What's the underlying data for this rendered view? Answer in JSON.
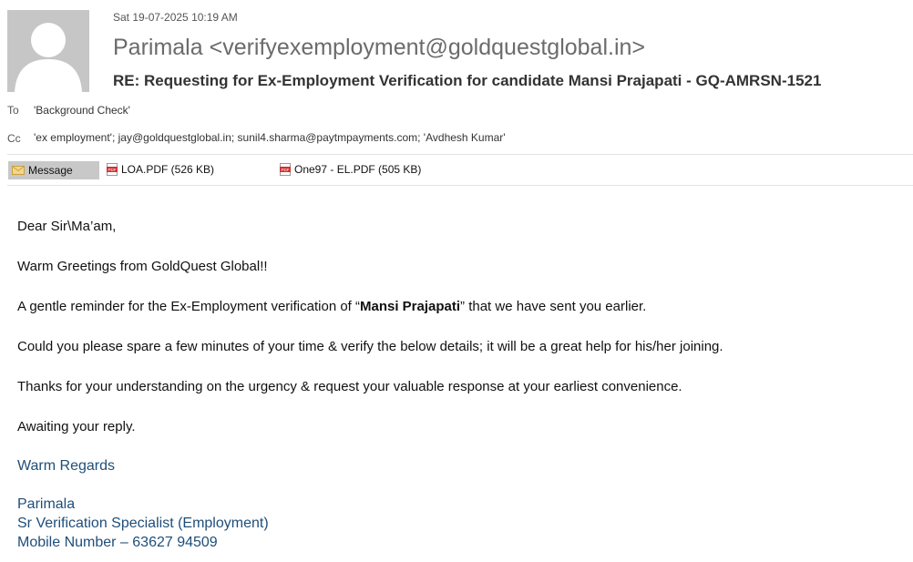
{
  "header": {
    "datetime": "Sat 19-07-2025 10:19 AM",
    "sender": "Parimala <verifyexemployment@goldquestglobal.in>",
    "subject": "RE: Requesting for Ex-Employment Verification for candidate Mansi Prajapati - GQ-AMRSN-1521",
    "to_label": "To",
    "to_value": "'Background Check'",
    "cc_label": "Cc",
    "cc_value": "'ex employment'; jay@goldquestglobal.in; sunil4.sharma@paytmpayments.com; 'Avdhesh Kumar'"
  },
  "attachments_bar": {
    "message_tab": "Message",
    "files": [
      {
        "name": "LOA.PDF (526 KB)",
        "icon": "pdf-icon"
      },
      {
        "name": "One97 - EL.PDF (505 KB)",
        "icon": "pdf-icon"
      }
    ]
  },
  "body": {
    "greeting": "Dear Sir\\Ma’am,",
    "line1": "Warm Greetings from GoldQuest Global!!",
    "line2_pre": "A gentle reminder for the Ex-Employment verification of “",
    "line2_name": "Mansi Prajapati",
    "line2_post": "” that we have sent you earlier.",
    "line3": "Could you please spare a few minutes of your time & verify the below details; it will be a great  help for his/her joining.",
    "line4": "Thanks for your understanding on the urgency & request your valuable response at your earliest convenience.",
    "line5": "Awaiting your reply."
  },
  "signature": {
    "closing": "Warm Regards",
    "name": "Parimala",
    "title": "Sr Verification Specialist (Employment)",
    "mobile": "Mobile Number – 63627 94509",
    "color": "#1f4e79"
  }
}
